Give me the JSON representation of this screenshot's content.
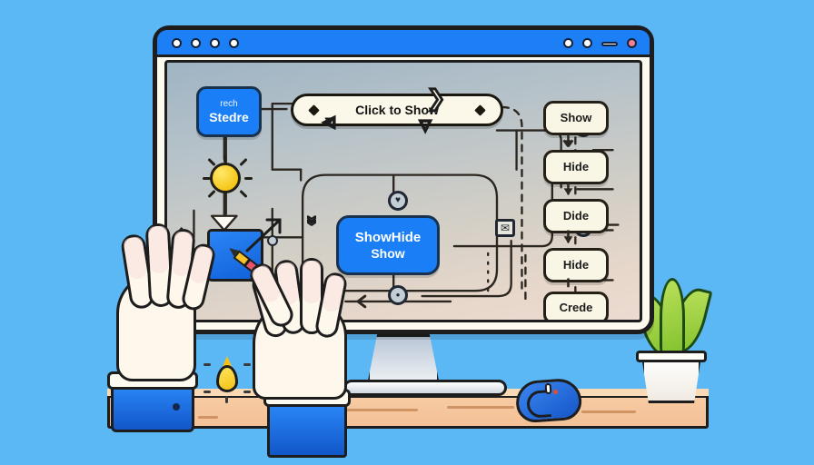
{
  "scene": {
    "background_color": "#5cb8f5",
    "desk_color": "#f5c49a",
    "accent_blue": "#1a7ef6",
    "node_cream": "#faf6e6",
    "outline": "#1d1d1d"
  },
  "window": {
    "titlebar_color": "#1d7ff5",
    "left_controls": [
      "circle",
      "circle",
      "circle",
      "circle"
    ],
    "right_controls": [
      "circle",
      "circle",
      "dash",
      "circle-red"
    ]
  },
  "diagram": {
    "left_node": {
      "sub_label": "rech",
      "label": "Stedre"
    },
    "banner": {
      "label": "Click to Show",
      "left_marker": "diamond",
      "right_marker": "diamond"
    },
    "center_node": {
      "label": "ShowHide",
      "sub_label": "Show"
    },
    "right_column": [
      {
        "label": "Show"
      },
      {
        "label": "Hide"
      },
      {
        "label": "Dide"
      },
      {
        "label": "Hide"
      },
      {
        "label": "Crede"
      }
    ],
    "markers": [
      {
        "name": "heart-marker",
        "glyph": "♥"
      },
      {
        "name": "dot-marker",
        "glyph": "●"
      },
      {
        "name": "chevron-down-marker",
        "glyph": "»"
      },
      {
        "name": "envelope-marker",
        "glyph": "✉"
      },
      {
        "name": "loop-marker",
        "glyph": "↺"
      },
      {
        "name": "chevron-right-marker",
        "glyph": "›"
      }
    ],
    "chevrons": [
      {
        "glyph": "❯"
      },
      {
        "glyph": "❯"
      },
      {
        "glyph": "❯"
      },
      {
        "glyph": "◁"
      },
      {
        "glyph": "▽"
      }
    ],
    "bulb": {
      "name": "lightbulb",
      "color": "#f6c71a"
    }
  },
  "desk_items": {
    "mouse": {
      "name": "computer-mouse",
      "color": "#1556c8"
    },
    "plant": {
      "name": "potted-plant",
      "pot_color": "#ffffff",
      "leaf_color": "#84c22e"
    },
    "card": {
      "name": "blue-card",
      "color": "#1260d8"
    },
    "pencil": {
      "name": "pencil",
      "body_color": "#e8556a",
      "tip_color": "#f6c42a"
    },
    "droplet": {
      "name": "yellow-droplet",
      "color": "#f3c215"
    }
  },
  "hands": {
    "left": {
      "name": "left-hand",
      "cuff_color": "#1157c9"
    },
    "right": {
      "name": "right-hand",
      "cuff_color": "#1157c9"
    }
  }
}
